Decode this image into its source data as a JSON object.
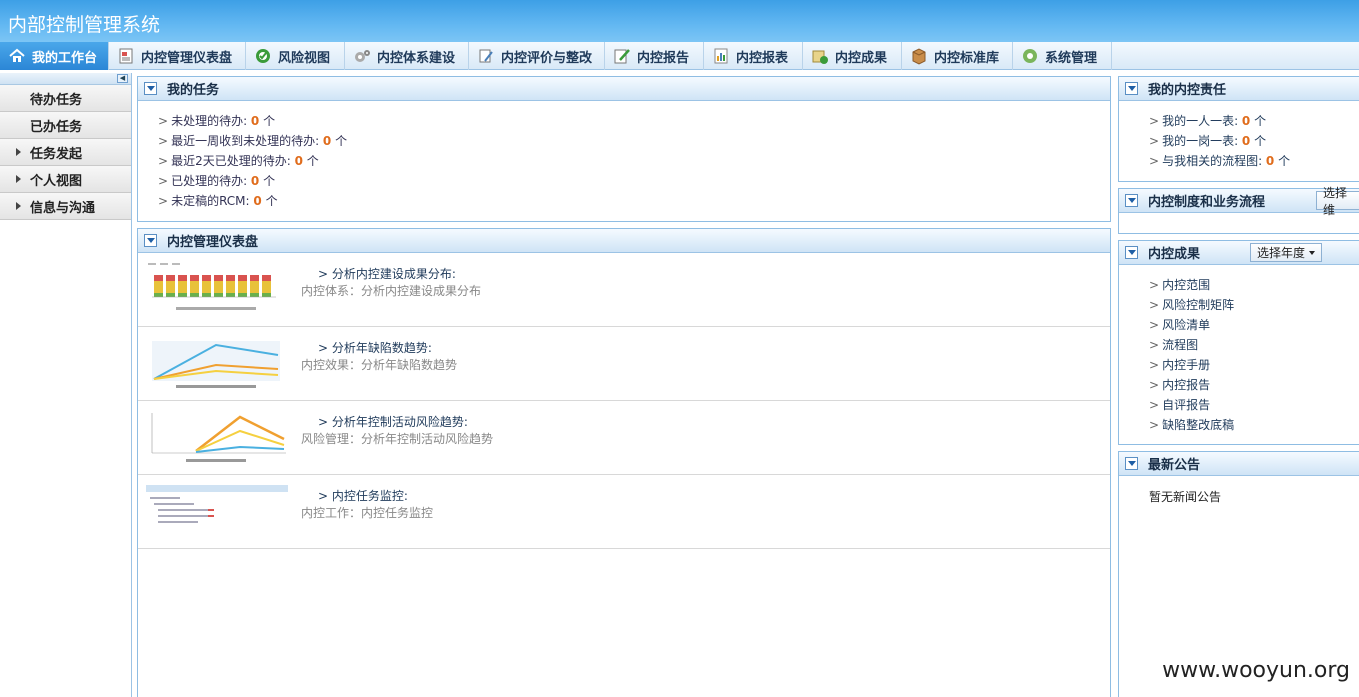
{
  "app": {
    "title": "内部控制管理系统"
  },
  "nav": [
    {
      "label": "我的工作台",
      "icon": "home-icon",
      "active": true
    },
    {
      "label": "内控管理仪表盘",
      "icon": "dashboard-icon"
    },
    {
      "label": "风险视图",
      "icon": "risk-view-icon"
    },
    {
      "label": "内控体系建设",
      "icon": "gears-icon"
    },
    {
      "label": "内控评价与整改",
      "icon": "evaluate-icon"
    },
    {
      "label": "内控报告",
      "icon": "report-edit-icon"
    },
    {
      "label": "内控报表",
      "icon": "report-chart-icon"
    },
    {
      "label": "内控成果",
      "icon": "results-icon"
    },
    {
      "label": "内控标准库",
      "icon": "standard-library-icon"
    },
    {
      "label": "系统管理",
      "icon": "settings-gear-icon"
    }
  ],
  "sidebar": {
    "items": [
      {
        "label": "待办任务",
        "expandable": false
      },
      {
        "label": "已办任务",
        "expandable": false
      },
      {
        "label": "任务发起",
        "expandable": true
      },
      {
        "label": "个人视图",
        "expandable": true
      },
      {
        "label": "信息与沟通",
        "expandable": true
      }
    ]
  },
  "my_tasks": {
    "title": "我的任务",
    "items": [
      {
        "label": "未处理的待办: ",
        "count": "0",
        "unit": " 个"
      },
      {
        "label": "最近一周收到未处理的待办: ",
        "count": "0",
        "unit": " 个"
      },
      {
        "label": "最近2天已处理的待办: ",
        "count": "0",
        "unit": " 个"
      },
      {
        "label": "已处理的待办: ",
        "count": "0",
        "unit": " 个"
      },
      {
        "label": "未定稿的RCM: ",
        "count": "0",
        "unit": " 个"
      }
    ]
  },
  "dashboard": {
    "title": "内控管理仪表盘",
    "rows": [
      {
        "title": "> 分析内控建设成果分布:",
        "subtitle": "内控体系：分析内控建设成果分布"
      },
      {
        "title": "> 分析年缺陷数趋势:",
        "subtitle": "内控效果：分析年缺陷数趋势"
      },
      {
        "title": "> 分析年控制活动风险趋势:",
        "subtitle": "风险管理：分析年控制活动风险趋势"
      },
      {
        "title": "> 内控任务监控:",
        "subtitle": "内控工作：内控任务监控"
      }
    ]
  },
  "my_responsibility": {
    "title": "我的内控责任",
    "items": [
      {
        "label": "我的一人一表: ",
        "count": "0",
        "unit": " 个"
      },
      {
        "label": "我的一岗一表: ",
        "count": "0",
        "unit": " 个"
      },
      {
        "label": "与我相关的流程图: ",
        "count": "0",
        "unit": " 个"
      }
    ]
  },
  "policy": {
    "title": "内控制度和业务流程",
    "select_label": "选择维"
  },
  "results": {
    "title": "内控成果",
    "select_label": "选择年度",
    "links": [
      "内控范围",
      "风险控制矩阵",
      "风险清单",
      "流程图",
      "内控手册",
      "内控报告",
      "自评报告",
      "缺陷整改底稿"
    ]
  },
  "news": {
    "title": "最新公告",
    "empty_text": "暂无新闻公告"
  },
  "watermark": "www.wooyun.org"
}
